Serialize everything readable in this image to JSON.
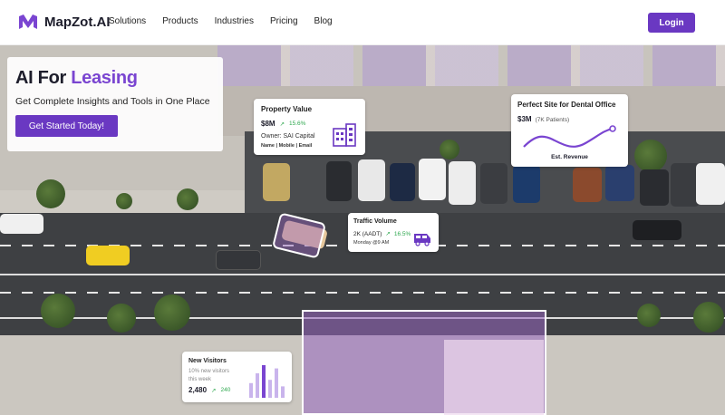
{
  "brand": {
    "name": "MapZot.AI",
    "accent": "#6a38c2"
  },
  "nav": {
    "items": [
      "Solutions",
      "Products",
      "Industries",
      "Pricing",
      "Blog"
    ],
    "login_label": "Login"
  },
  "hero": {
    "title_prefix": "AI For ",
    "title_accent": "Leasing",
    "subtitle": "Get Complete Insights and Tools in One Place",
    "cta_label": "Get Started Today!"
  },
  "property_card": {
    "title": "Property Value",
    "value": "$8M",
    "change": "15.6%",
    "owner": "Owner: SAI Capital",
    "links": "Name | Mobile | Email",
    "icon": "building-icon"
  },
  "site_card": {
    "title": "Perfect Site for Dental Office",
    "value": "$3M",
    "patients": "(7K Patients)",
    "footer": "Est. Revenue"
  },
  "traffic_card": {
    "title": "Traffic Volume",
    "value": "2K (AADT)",
    "change": "16.5%",
    "time": "Monday @9 AM",
    "icon": "van-icon"
  },
  "visitors_card": {
    "title": "New Visitors",
    "subtitle": "10% new visitors this week",
    "count": "2,480",
    "change": "240",
    "bars": [
      0.45,
      0.75,
      1.0,
      0.55,
      0.9,
      0.35
    ]
  }
}
